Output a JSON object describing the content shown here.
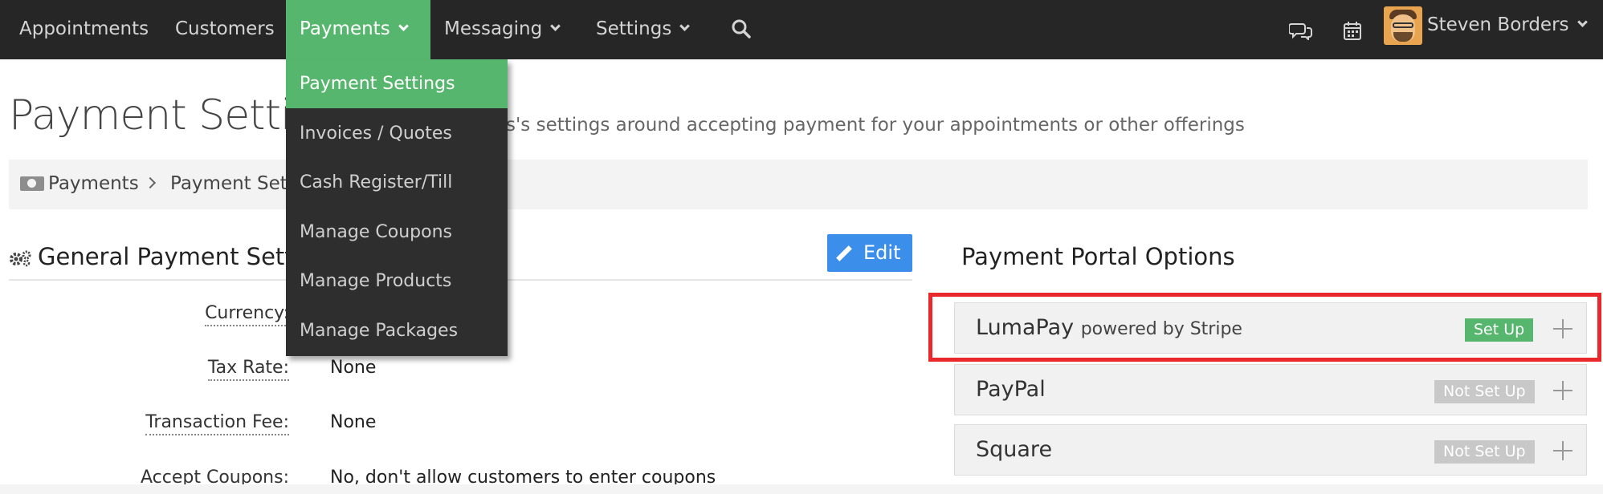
{
  "nav": {
    "items": [
      {
        "label": "Appointments"
      },
      {
        "label": "Customers"
      },
      {
        "label": "Payments"
      },
      {
        "label": "Messaging"
      },
      {
        "label": "Settings"
      }
    ],
    "user_name": "Steven Borders"
  },
  "dropdown": {
    "items": [
      {
        "label": "Payment Settings"
      },
      {
        "label": "Invoices / Quotes"
      },
      {
        "label": "Cash Register/Till"
      },
      {
        "label": "Manage Coupons"
      },
      {
        "label": "Manage Products"
      },
      {
        "label": "Manage Packages"
      }
    ]
  },
  "page": {
    "title": "Payment Settings",
    "subtitle": "s's settings around accepting payment for your appointments or other offerings"
  },
  "breadcrumb": {
    "items": [
      {
        "label": "Payments"
      },
      {
        "label": "Payment Settings"
      }
    ]
  },
  "general": {
    "title": "General Payment Settings",
    "edit_label": "Edit",
    "fields": [
      {
        "label": "Currency:",
        "value": ""
      },
      {
        "label": "Tax Rate:",
        "value": "None"
      },
      {
        "label": "Transaction Fee:",
        "value": "None"
      },
      {
        "label": "Accept Coupons:",
        "value": "No, don't allow customers to enter coupons"
      }
    ]
  },
  "portals": {
    "title": "Payment Portal Options",
    "items": [
      {
        "name": "LumaPay",
        "sub": "powered by Stripe",
        "status": "Set Up"
      },
      {
        "name": "PayPal",
        "sub": "",
        "status": "Not Set Up"
      },
      {
        "name": "Square",
        "sub": "",
        "status": "Not Set Up"
      }
    ]
  },
  "colors": {
    "nav_bg": "#262626",
    "accent_green": "#57b66d",
    "edit_blue": "#3b8eea",
    "highlight_red": "#e8282b"
  },
  "icons": [
    "search-icon",
    "chat-icon",
    "calendar-icon",
    "money-icon",
    "gear-icon",
    "pencil-icon",
    "plus-icon",
    "chevron-down-icon"
  ]
}
